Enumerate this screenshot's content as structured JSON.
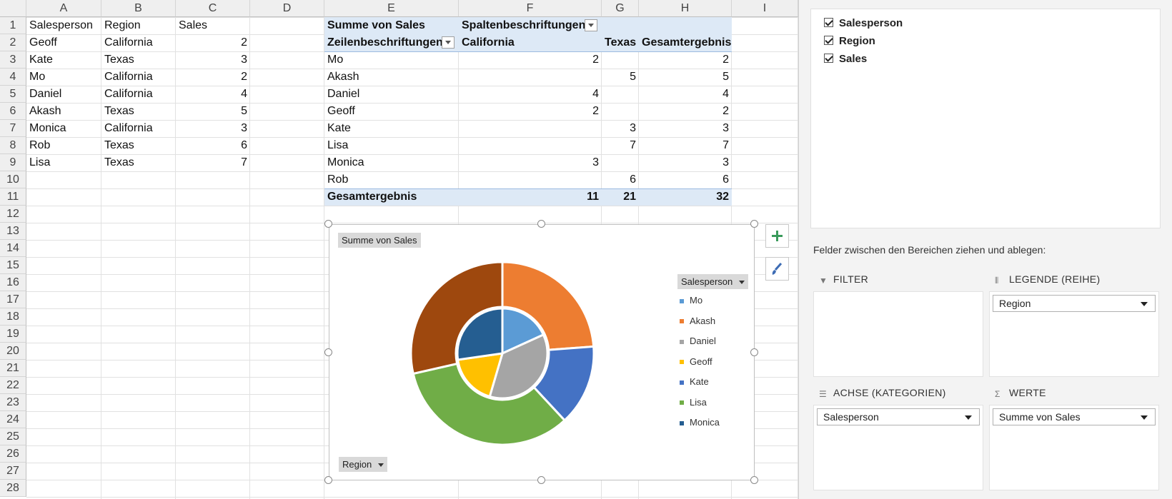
{
  "sheet": {
    "columns": [
      "A",
      "B",
      "C",
      "D",
      "E",
      "F",
      "G",
      "H",
      "I"
    ],
    "rows": [
      "1",
      "2",
      "3",
      "4",
      "5",
      "6",
      "7",
      "8",
      "9",
      "10",
      "11",
      "12",
      "13",
      "14",
      "15",
      "16",
      "17",
      "18",
      "19",
      "20",
      "21",
      "22",
      "23",
      "24",
      "25",
      "26",
      "27",
      "28"
    ],
    "source_headers": [
      "Salesperson",
      "Region",
      "Sales"
    ],
    "source_rows": [
      [
        "Geoff",
        "California",
        "2"
      ],
      [
        "Kate",
        "Texas",
        "3"
      ],
      [
        "Mo",
        "California",
        "2"
      ],
      [
        "Daniel",
        "California",
        "4"
      ],
      [
        "Akash",
        "Texas",
        "5"
      ],
      [
        "Monica",
        "California",
        "3"
      ],
      [
        "Rob",
        "Texas",
        "6"
      ],
      [
        "Lisa",
        "Texas",
        "7"
      ]
    ]
  },
  "pivot": {
    "value_label": "Summe von Sales",
    "col_labels_caption": "Spaltenbeschriftungen",
    "row_labels_caption": "Zeilenbeschriftungen",
    "col_california": "California",
    "col_texas": "Texas",
    "col_total": "Gesamtergebnis",
    "rows": [
      {
        "name": "Mo",
        "california": "2",
        "texas": "",
        "total": "2"
      },
      {
        "name": "Akash",
        "california": "",
        "texas": "5",
        "total": "5"
      },
      {
        "name": "Daniel",
        "california": "4",
        "texas": "",
        "total": "4"
      },
      {
        "name": "Geoff",
        "california": "2",
        "texas": "",
        "total": "2"
      },
      {
        "name": "Kate",
        "california": "",
        "texas": "3",
        "total": "3"
      },
      {
        "name": "Lisa",
        "california": "",
        "texas": "7",
        "total": "7"
      },
      {
        "name": "Monica",
        "california": "3",
        "texas": "",
        "total": "3"
      },
      {
        "name": "Rob",
        "california": "",
        "texas": "6",
        "total": "6"
      }
    ],
    "grand_total_label": "Gesamtergebnis",
    "grand_california": "11",
    "grand_texas": "21",
    "grand_total": "32"
  },
  "chart_data": {
    "type": "pie",
    "subtype": "doughnut",
    "title": "Summe von Sales",
    "legend_title": "Salesperson",
    "axis_field_button": "Region",
    "legend_placement": "right",
    "legend": [
      "Mo",
      "Akash",
      "Daniel",
      "Geoff",
      "Kate",
      "Lisa",
      "Monica"
    ],
    "series": [
      {
        "values": [
          2,
          5,
          4,
          2,
          3,
          7,
          3,
          6
        ]
      },
      {
        "values": [
          11,
          21
        ]
      }
    ],
    "colors": {
      "Mo": "#5b9bd5",
      "Akash": "#ed7d31",
      "Daniel": "#a5a5a5",
      "Geoff": "#ffc000",
      "Kate": "#4472c4",
      "Lisa": "#70ad47",
      "Monica": "#255e91",
      "Rob": "#9e480e"
    }
  },
  "chart_buttons": {
    "add_icon": "plus-icon",
    "style_icon": "paintbrush-icon"
  },
  "panel": {
    "fields": [
      "Salesperson",
      "Region",
      "Sales"
    ],
    "drag_hint": "Felder zwischen den Bereichen ziehen und ablegen:",
    "filter_title": "FILTER",
    "legend_title": "LEGENDE (REIHE)",
    "legend_field": "Region",
    "axis_title": "ACHSE (KATEGORIEN)",
    "axis_field": "Salesperson",
    "values_title": "WERTE",
    "values_field": "Summe von Sales"
  }
}
